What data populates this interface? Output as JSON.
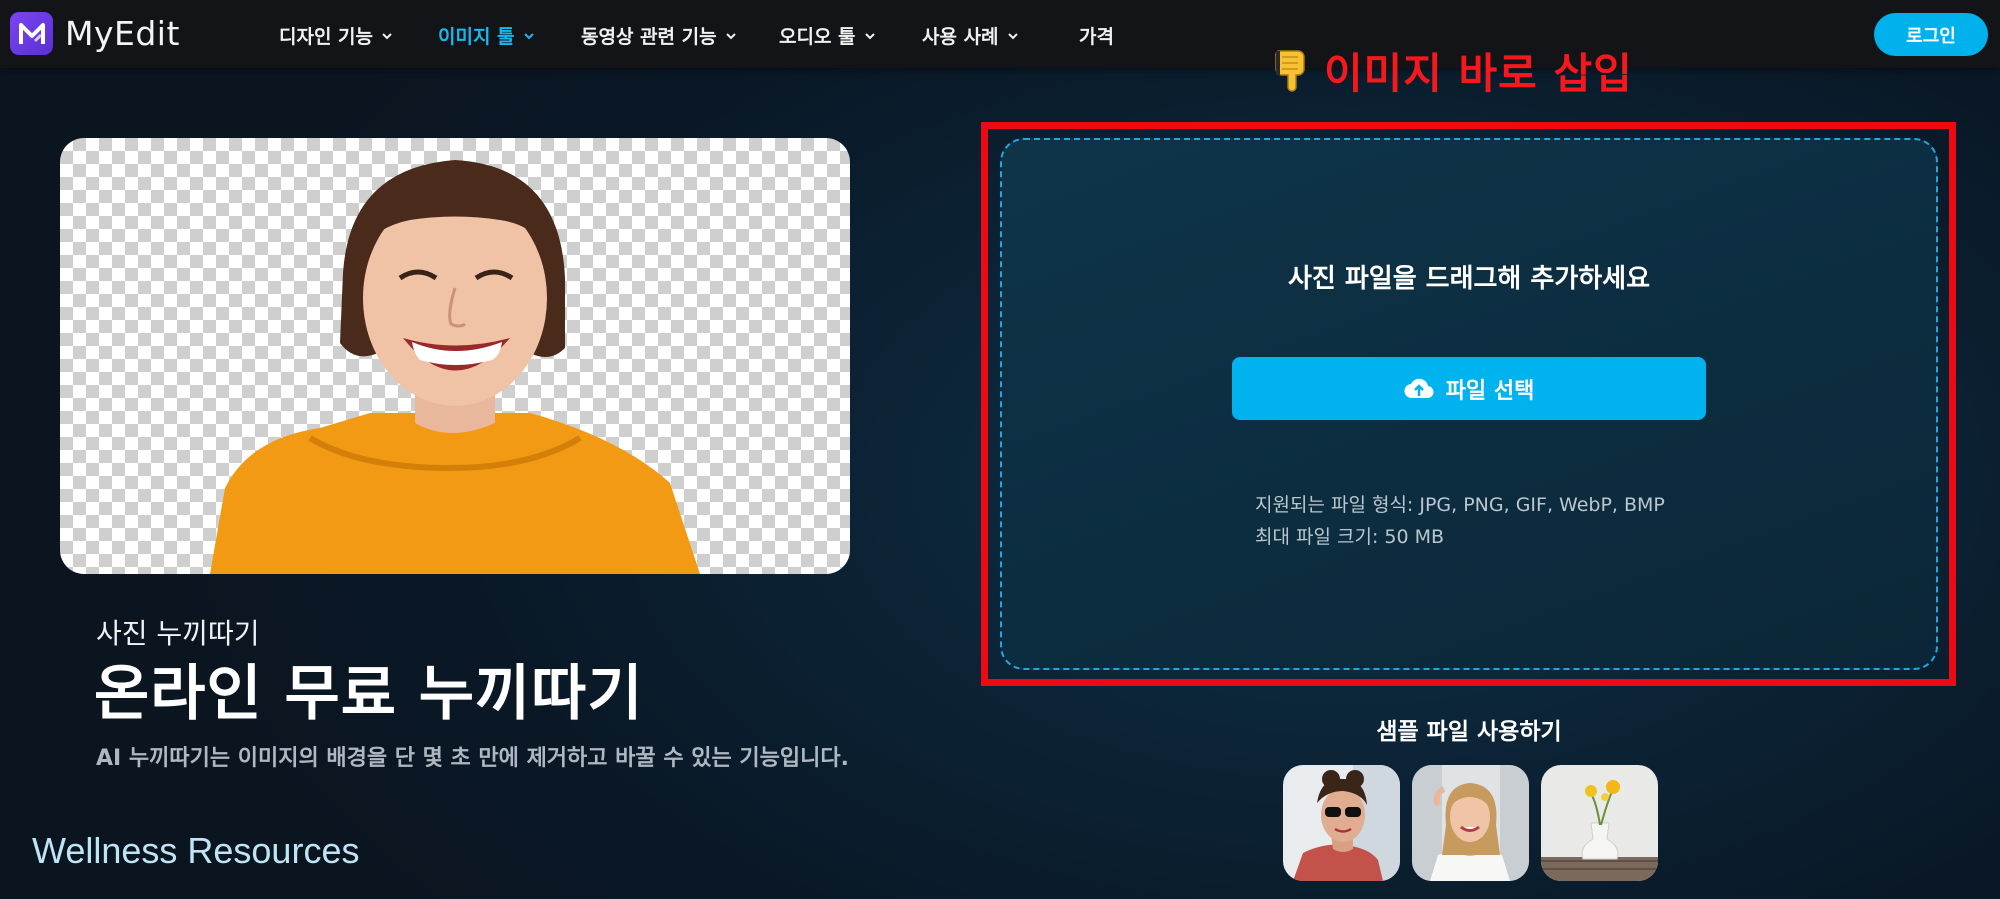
{
  "brand": {
    "name": "MyEdit",
    "logo_letter": "M"
  },
  "nav": {
    "items": [
      {
        "label": "디자인 기능",
        "dropdown": true,
        "active": false
      },
      {
        "label": "이미지 툴",
        "dropdown": true,
        "active": true
      },
      {
        "label": "동영상 관련 기능",
        "dropdown": true,
        "active": false
      },
      {
        "label": "오디오 툴",
        "dropdown": true,
        "active": false
      },
      {
        "label": "사용 사례",
        "dropdown": true,
        "active": false
      },
      {
        "label": "가격",
        "dropdown": false,
        "active": false
      }
    ],
    "login_label": "로그인"
  },
  "annotation": {
    "text": "이미지 바로 삽입",
    "icon": "pointing-down-hand-icon",
    "color": "#f5181c"
  },
  "hero": {
    "subtitle": "사진 누끼따기",
    "title": "온라인 무료 누끼따기",
    "description": "AI 누끼따기는 이미지의 배경을 단 몇 초 만에 제거하고 바꿀 수 있는 기능입니다."
  },
  "upload": {
    "drop_text": "사진 파일을 드래그해 추가하세요",
    "button_label": "파일 선택",
    "button_icon": "cloud-upload-icon",
    "formats": "지원되는 파일 형식: JPG, PNG, GIF, WebP, BMP",
    "max_size": "최대 파일 크기: 50 MB"
  },
  "samples": {
    "title": "샘플 파일 사용하기"
  },
  "footer_overlay": {
    "text": "Wellness Resources"
  },
  "colors": {
    "accent": "#00b1ec",
    "active_nav": "#1cb6ee",
    "highlight_red": "#ee0a12",
    "nav_bg": "#121417"
  }
}
